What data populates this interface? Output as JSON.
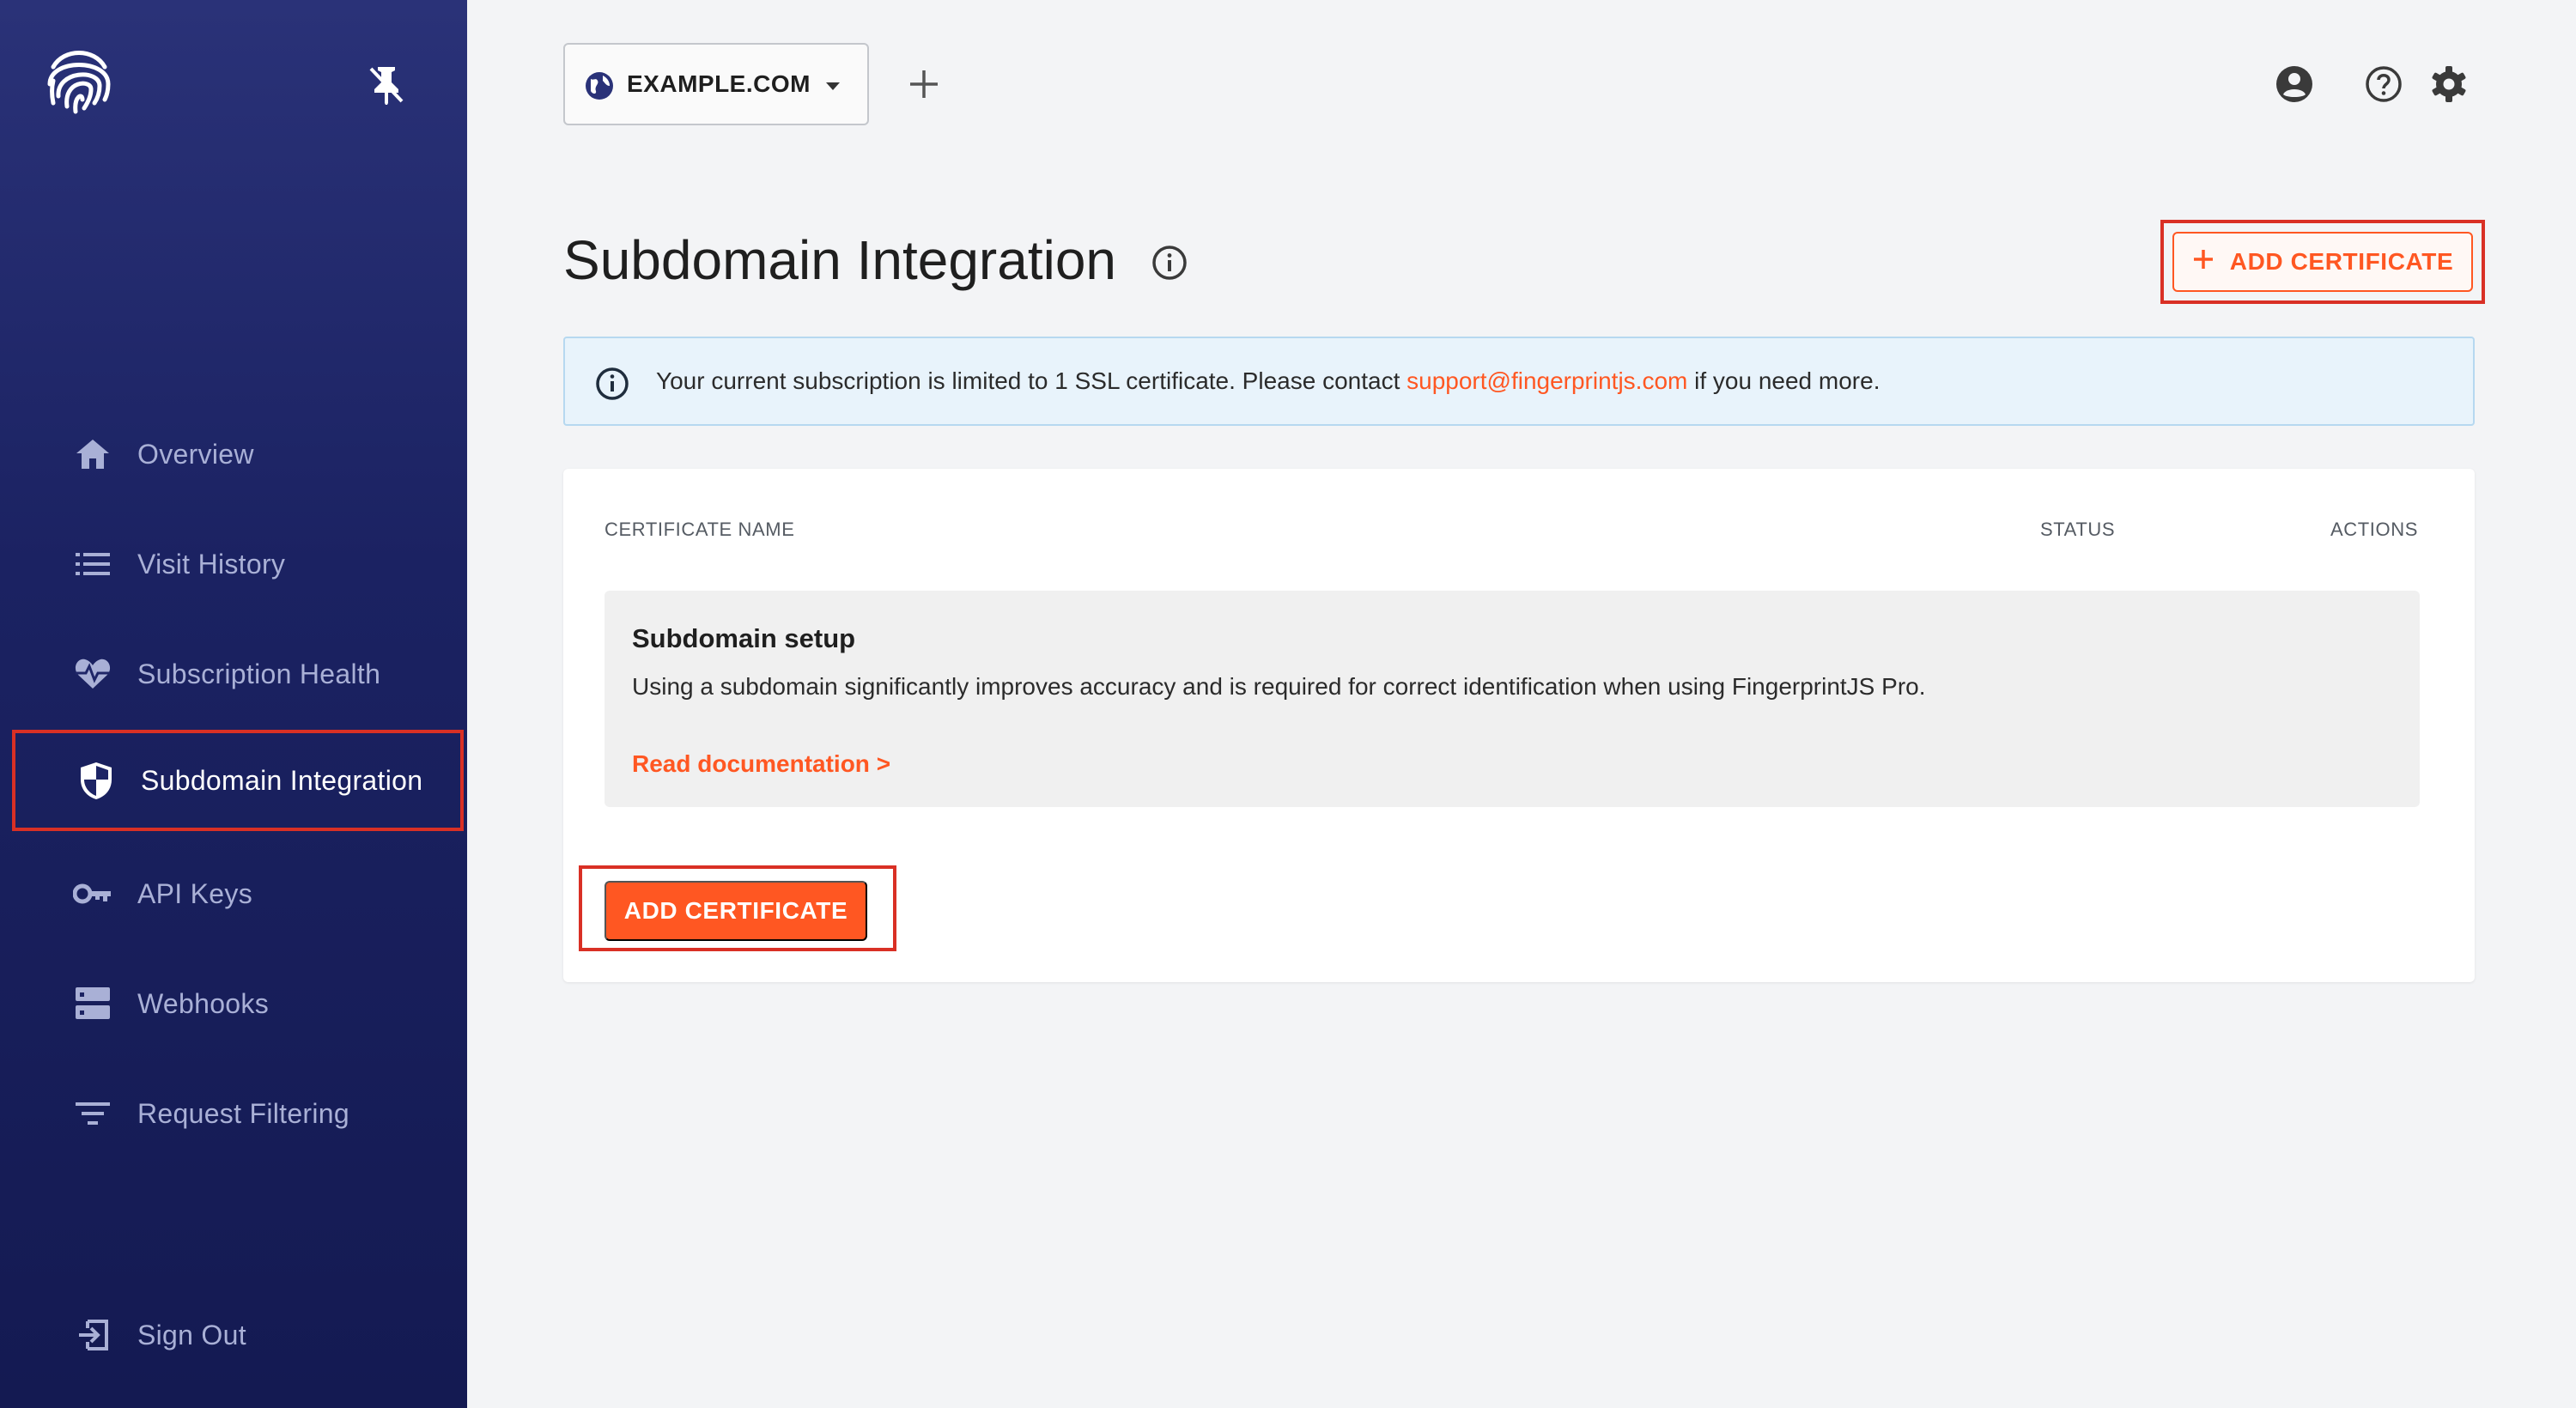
{
  "sidebar": {
    "logo_icon": "fingerprint-icon",
    "pin_icon": "pin-off-icon",
    "items": [
      {
        "label": "Overview",
        "icon": "home-icon"
      },
      {
        "label": "Visit History",
        "icon": "list-icon"
      },
      {
        "label": "Subscription Health",
        "icon": "heart-pulse-icon"
      },
      {
        "label": "Subdomain Integration",
        "icon": "shield-icon",
        "active": true
      },
      {
        "label": "API Keys",
        "icon": "key-icon"
      },
      {
        "label": "Webhooks",
        "icon": "server-icon"
      },
      {
        "label": "Request Filtering",
        "icon": "filter-icon"
      }
    ],
    "sign_out": {
      "label": "Sign Out",
      "icon": "sign-out-icon"
    }
  },
  "topbar": {
    "domain": "EXAMPLE.COM",
    "icons": [
      "globe-icon",
      "caret-down-icon",
      "plus-icon",
      "account-icon",
      "help-icon",
      "settings-icon"
    ]
  },
  "page": {
    "title": "Subdomain Integration",
    "add_certificate_top": "ADD CERTIFICATE"
  },
  "alert": {
    "text_before": "Your current subscription is limited to 1 SSL certificate. Please contact ",
    "link": "support@fingerprintjs.com",
    "text_after": " if you need more."
  },
  "table": {
    "headers": {
      "name": "CERTIFICATE NAME",
      "status": "STATUS",
      "actions": "ACTIONS"
    },
    "empty": {
      "title": "Subdomain setup",
      "description": "Using a subdomain significantly improves accuracy and is required for correct identification when using FingerprintJS Pro.",
      "link": "Read documentation >"
    },
    "add_certificate_bottom": "ADD CERTIFICATE"
  },
  "colors": {
    "sidebar_top": "#2a3278",
    "sidebar_bottom": "#141a52",
    "accent": "#ff5722",
    "highlight": "#d93025",
    "alert_bg": "#e8f3fb"
  }
}
